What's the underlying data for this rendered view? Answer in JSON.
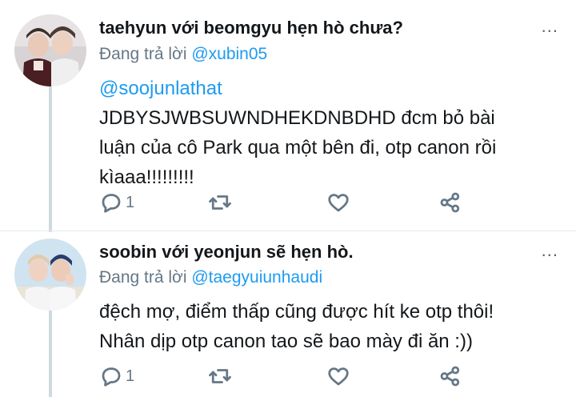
{
  "tweets": [
    {
      "display_name": "taehyun với beomgyu hẹn hò chưa?",
      "more": "...",
      "replying_prefix": "Đang trả lời",
      "replying_handle": "@xubin05",
      "mention": "@soojunlathat",
      "text_lines": [
        "JDBYSJWBSUWNDHEKDNBDHD đcm bỏ bài",
        "luận của cô Park qua một bên đi, otp canon rồi",
        "kìaaa!!!!!!!!!"
      ],
      "reply_count": "1",
      "icons": [
        "comment-icon",
        "retweet-icon",
        "heart-icon",
        "share-icon"
      ]
    },
    {
      "display_name": "soobin với yeonjun sẽ hẹn hò.",
      "more": "...",
      "replying_prefix": "Đang trả lời",
      "replying_handle": "@taegyuiunhaudi",
      "text_lines": [
        "đệch mợ, điểm thấp cũng được hít ke otp thôi!",
        "Nhân dịp otp canon tao sẽ bao mày đi ăn :))"
      ],
      "reply_count": "1",
      "icons": [
        "comment-icon",
        "retweet-icon",
        "heart-icon",
        "share-icon"
      ]
    }
  ],
  "colors": {
    "link": "#1d9bf0",
    "secondary": "#657786",
    "thread_line": "#cfd9de"
  }
}
